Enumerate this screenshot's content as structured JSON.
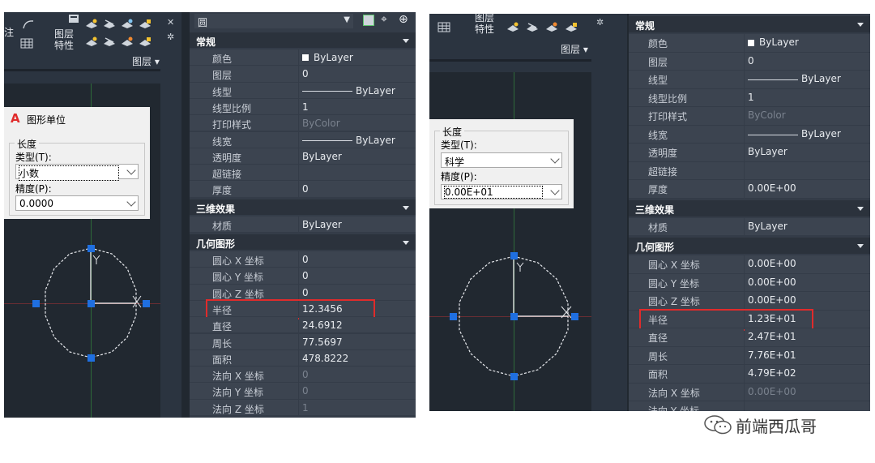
{
  "left": {
    "ribbon": {
      "layer_props_label": "图层\n特性",
      "layer_panel_label": "图层",
      "partial_label": "注"
    },
    "dialog": {
      "title": "图形单位",
      "group_label": "长度",
      "type_label": "类型(T):",
      "type_value": "小数",
      "precision_label": "精度(P):",
      "precision_value": "0.0000"
    },
    "panel": {
      "combo_value": "圆",
      "sections": [
        "常规",
        "三维效果",
        "几何图形"
      ],
      "general": [
        {
          "k": "颜色",
          "v": "ByLayer",
          "type": "color"
        },
        {
          "k": "图层",
          "v": "0"
        },
        {
          "k": "线型",
          "v": "ByLayer",
          "type": "line"
        },
        {
          "k": "线型比例",
          "v": "1"
        },
        {
          "k": "打印样式",
          "v": "ByColor",
          "dim": true
        },
        {
          "k": "线宽",
          "v": "ByLayer",
          "type": "line"
        },
        {
          "k": "透明度",
          "v": "ByLayer"
        },
        {
          "k": "超链接",
          "v": ""
        },
        {
          "k": "厚度",
          "v": "0"
        }
      ],
      "effects": [
        {
          "k": "材质",
          "v": "ByLayer"
        }
      ],
      "geometry": [
        {
          "k": "圆心 X 坐标",
          "v": "0"
        },
        {
          "k": "圆心 Y 坐标",
          "v": "0"
        },
        {
          "k": "圆心 Z 坐标",
          "v": "0"
        },
        {
          "k": "半径",
          "v": "12.3456"
        },
        {
          "k": "直径",
          "v": "24.6912"
        },
        {
          "k": "周长",
          "v": "77.5697"
        },
        {
          "k": "面积",
          "v": "478.8222"
        },
        {
          "k": "法向 X 坐标",
          "v": "0",
          "dim": true
        },
        {
          "k": "法向 Y 坐标",
          "v": "0",
          "dim": true
        },
        {
          "k": "法向 Z 坐标",
          "v": "1",
          "dim": true
        }
      ]
    }
  },
  "right": {
    "ribbon": {
      "layer_props_label": "图层\n特性",
      "layer_panel_label": "图层"
    },
    "dialog": {
      "group_label": "长度",
      "type_label": "类型(T):",
      "type_value": "科学",
      "precision_label": "精度(P):",
      "precision_value": "0.00E+01"
    },
    "panel": {
      "sections": [
        "常规",
        "三维效果",
        "几何图形"
      ],
      "general": [
        {
          "k": "颜色",
          "v": "ByLayer",
          "type": "color"
        },
        {
          "k": "图层",
          "v": "0"
        },
        {
          "k": "线型",
          "v": "ByLayer",
          "type": "line"
        },
        {
          "k": "线型比例",
          "v": "1"
        },
        {
          "k": "打印样式",
          "v": "ByColor",
          "dim": true
        },
        {
          "k": "线宽",
          "v": "ByLayer",
          "type": "line"
        },
        {
          "k": "透明度",
          "v": "ByLayer"
        },
        {
          "k": "超链接",
          "v": ""
        },
        {
          "k": "厚度",
          "v": "0.00E+00"
        }
      ],
      "effects": [
        {
          "k": "材质",
          "v": "ByLayer"
        }
      ],
      "geometry": [
        {
          "k": "圆心 X 坐标",
          "v": "0.00E+00"
        },
        {
          "k": "圆心 Y 坐标",
          "v": "0.00E+00"
        },
        {
          "k": "圆心 Z 坐标",
          "v": "0.00E+00"
        },
        {
          "k": "半径",
          "v": "1.23E+01"
        },
        {
          "k": "直径",
          "v": "2.47E+01"
        },
        {
          "k": "周长",
          "v": "7.76E+01"
        },
        {
          "k": "面积",
          "v": "4.79E+02"
        },
        {
          "k": "法向 X 坐标",
          "v": "0.00E+00",
          "dim": true
        },
        {
          "k": "法向 Y 坐标",
          "v": "",
          "dim": true
        }
      ]
    }
  },
  "watermark": "前端西瓜哥",
  "colors": {
    "highlight": "#e02b2b",
    "grip": "#1f6fe0",
    "panel": "#343c48",
    "canvas": "#212830"
  }
}
